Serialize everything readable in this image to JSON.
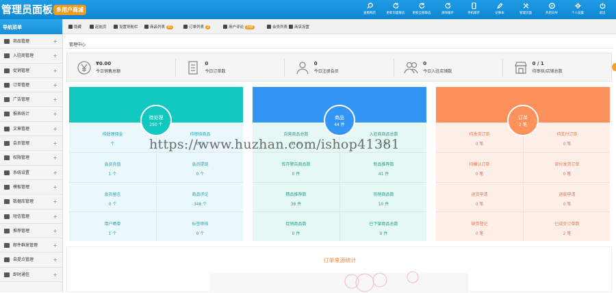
{
  "header": {
    "title": "管理员面板",
    "badge": "多用户商城",
    "items": [
      {
        "label": "查看网店",
        "icon": "search-icon"
      },
      {
        "label": "更新页面静态",
        "icon": "refresh-icon"
      },
      {
        "label": "更新全部静态",
        "icon": "refresh-icon"
      },
      {
        "label": "清除缓存",
        "icon": "refresh-icon"
      },
      {
        "label": "手机版存",
        "icon": "phone-icon"
      },
      {
        "label": "记事本",
        "icon": "pen-icon"
      },
      {
        "label": "管理页面",
        "icon": "tools-icon"
      },
      {
        "label": "开店向导",
        "icon": "play-icon"
      },
      {
        "label": "个人设置",
        "icon": "gear-icon"
      },
      {
        "label": "退出",
        "icon": "power-icon"
      }
    ]
  },
  "sidebar": {
    "heading": "导航菜单",
    "items": [
      {
        "label": "商品管理"
      },
      {
        "label": "入驻商管理"
      },
      {
        "label": "促销管理"
      },
      {
        "label": "订单管理"
      },
      {
        "label": "广告管理"
      },
      {
        "label": "报表统计"
      },
      {
        "label": "文章管理"
      },
      {
        "label": "会员管理"
      },
      {
        "label": "权限管理"
      },
      {
        "label": "系统设置"
      },
      {
        "label": "模板管理"
      },
      {
        "label": "数据库管理"
      },
      {
        "label": "短信管理"
      },
      {
        "label": "推荐管理"
      },
      {
        "label": "邮件群发管理"
      },
      {
        "label": "自提点管理"
      },
      {
        "label": "即时通信"
      }
    ]
  },
  "subbar": {
    "items": [
      {
        "label": "隐藏",
        "badge": ""
      },
      {
        "label": "起始页",
        "badge": ""
      },
      {
        "label": "设置导航栏",
        "badge": ""
      },
      {
        "label": "商品列表",
        "badge": "41"
      },
      {
        "label": "订单列表",
        "badge": "2"
      },
      {
        "label": "用户评论",
        "badge": "348"
      },
      {
        "label": "会员列表",
        "badge": ""
      },
      {
        "label": "商店设置",
        "badge": ""
      }
    ]
  },
  "breadcrumb": "管理中心",
  "stats": [
    {
      "value": "¥0.00",
      "label": "今日销售总额",
      "icon": "yen-icon"
    },
    {
      "value": "0",
      "label": "今日订单数",
      "icon": "document-icon"
    },
    {
      "value": "0",
      "label": "今日注册会员",
      "icon": "user-icon"
    },
    {
      "value": "0",
      "label": "今日入驻店铺数",
      "icon": "users-icon"
    },
    {
      "value": "0 / 1",
      "label": "待审核/店铺总数",
      "icon": "shop-icon"
    }
  ],
  "panels": [
    {
      "title": "待处理",
      "count": "250 个",
      "color": "#12c9c2",
      "body": "#eaf7fb",
      "text": "#1aa8b8",
      "cells": [
        {
          "label": "待处理佣金",
          "value": "个"
        },
        {
          "label": "待审核商品",
          "value": "0 个"
        },
        {
          "label": "会员充值",
          "value": "1 个"
        },
        {
          "label": "会员提现",
          "value": "0 个"
        },
        {
          "label": "会员留言",
          "value": "0 个"
        },
        {
          "label": "商品评论",
          "value": "348 个"
        },
        {
          "label": "用户晒单",
          "value": "1 个"
        },
        {
          "label": "标签审核",
          "value": "0 个"
        }
      ]
    },
    {
      "title": "商品",
      "count": "44 件",
      "color": "#3396f5",
      "body": "#e6f8f4",
      "text": "#2a9a8e",
      "cells": [
        {
          "label": "自营商品总数",
          "value": "41 件"
        },
        {
          "label": "入驻商商品总数",
          "value": "3 件"
        },
        {
          "label": "库存警告商品数",
          "value": "0 件"
        },
        {
          "label": "新品推荐数",
          "value": "41 件"
        },
        {
          "label": "精品推荐数",
          "value": "38 件"
        },
        {
          "label": "热销商品数",
          "value": "10 件"
        },
        {
          "label": "促销商品数",
          "value": "0 件"
        },
        {
          "label": "已下架商品总数",
          "value": "0 件"
        }
      ]
    },
    {
      "title": "订单",
      "count": "2 笔",
      "color": "#fc915c",
      "body": "#fdeee8",
      "text": "#e9774a",
      "cells": [
        {
          "label": "待发货订单",
          "value": "0 笔"
        },
        {
          "label": "待支付订单",
          "value": "0 笔"
        },
        {
          "label": "待确认订单",
          "value": "0 笔"
        },
        {
          "label": "部分发货订单",
          "value": "0 笔"
        },
        {
          "label": "退货申请",
          "value": "0 笔"
        },
        {
          "label": "退款申请",
          "value": "0 笔"
        },
        {
          "label": "缺货登记",
          "value": "0 笔"
        },
        {
          "label": "已成交订单数",
          "value": "2 笔"
        }
      ]
    }
  ],
  "chart_section": {
    "title": "订单来源统计"
  },
  "watermark": "https://www.huzhan.com/ishop41381"
}
